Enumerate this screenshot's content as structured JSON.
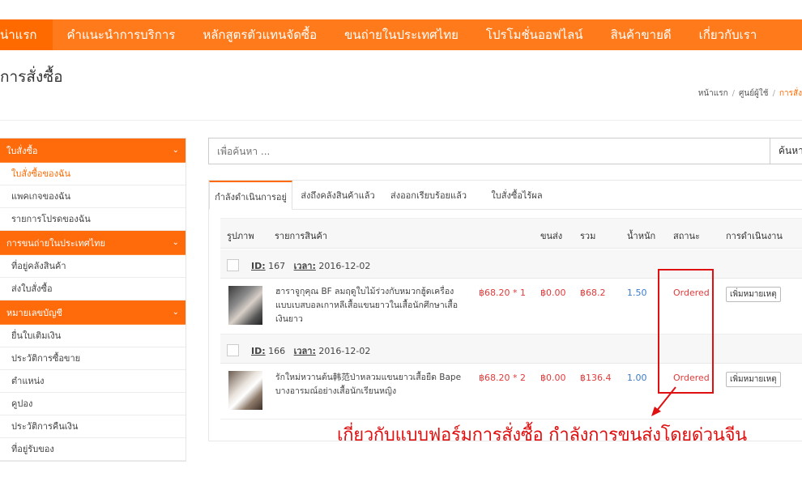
{
  "nav": {
    "items": [
      "น่าแรก",
      "คำแนะนำการบริการ",
      "หลักสูตรตัวแทนจัดซื้อ",
      "ขนถ่ายในประเทศไทย",
      "โปรโมชั่นออฟไลน์",
      "สินค้าขายดี",
      "เกี่ยวกับเรา"
    ]
  },
  "page": {
    "title": "การสั่งซื้อ"
  },
  "breadcrumb": {
    "home": "หน้าแรก",
    "member": "ศูนย์ผู้ใช้",
    "current": "การสั่ง"
  },
  "sidebar": {
    "groups": [
      {
        "label": "ใบสั่งซื้อ",
        "items": [
          "ใบสั่งซื้อของฉัน",
          "แพคเกจของฉัน",
          "รายการโปรดของฉัน"
        ]
      },
      {
        "label": "การขนถ่ายในประเทศไทย",
        "items": [
          "ที่อยู่คลังสินค้า",
          "ส่งใบสั่งซื้อ"
        ]
      },
      {
        "label": "หมายเลขบัญชี",
        "items": [
          "ยื่นใบเติมเงิน",
          "ประวัติการซื้อขาย",
          "ตำแหน่ง",
          "คูปอง",
          "ประวัติการคืนเงิน",
          "ที่อยู่รับของ"
        ]
      }
    ]
  },
  "search": {
    "placeholder": "เพื่อค้นหา ...",
    "button": "ค้นหา"
  },
  "tabs": [
    "กำลังดำเนินการอยู่",
    "ส่งถึงคลังสินค้าแล้ว",
    "ส่งออกเรียบร้อยแล้ว",
    "ใบสั่งซื้อไร้ผล"
  ],
  "table": {
    "headers": [
      "รูปภาพ",
      "รายการสินค้า",
      "ขนส่ง",
      "รวม",
      "น้ำหนัก",
      "สถานะ",
      "การดำเนินงาน"
    ],
    "id_label": "ID:",
    "time_label": "เวลา:",
    "orders": [
      {
        "id": "167",
        "date": "2016-12-02",
        "title": "ฮาราจูกุคุณ BF ลมฤดูใบไม้ร่วงกับหมวกฮู้ดเครื่องแบบเบสบอลเกาหลีเสื้อแขนยาวในเสื้อนักศึกษาเสื้อเงินยาว",
        "price": "฿68.20 * 1",
        "shipping": "฿0.00",
        "total": "฿68.2",
        "weight": "1.50",
        "status": "Ordered",
        "action": "เพิ่มหมายเหตุ"
      },
      {
        "id": "166",
        "date": "2016-12-02",
        "title": "รักใหม่หวานต้น韩范ป่าหลวมแขนยาวเสื้อยืด Bape บางอารมณ์อย่างเสื้อนักเรียนหญิง",
        "price": "฿68.20 * 2",
        "shipping": "฿0.00",
        "total": "฿136.4",
        "weight": "1.00",
        "status": "Ordered",
        "action": "เพิ่มหมายเหตุ"
      }
    ]
  },
  "annotation": {
    "text": "เกี่ยวกับแบบฟอร์มการสั่งซื้อ กำลังการขนส่งโดยด่วนจีน"
  },
  "colors": {
    "brand": "#ff6a00",
    "status": "#e03a3a",
    "weight": "#3a7bc8",
    "annotation": "#e01010"
  }
}
